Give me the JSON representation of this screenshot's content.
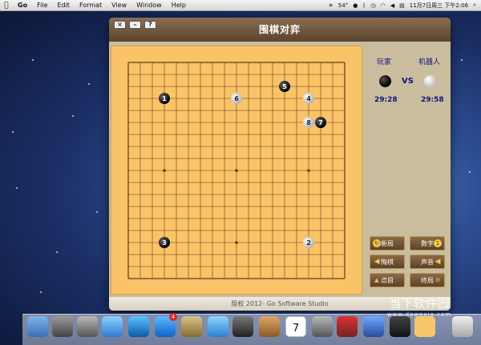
{
  "menubar": {
    "app": "Go",
    "items": [
      "File",
      "Edit",
      "Format",
      "View",
      "Window",
      "Help"
    ],
    "temperature": "54°",
    "datetime": "11月7日周三 下午2:06"
  },
  "window": {
    "title": "围棋对弈",
    "btn_close": "×",
    "btn_min": "–",
    "btn_help": "?",
    "footer": "版权 2012- Go Software Studio"
  },
  "panel": {
    "player_label": "玩家",
    "robot_label": "机器人",
    "vs": "VS",
    "player_time": "29:28",
    "robot_time": "29:58"
  },
  "controls": {
    "new_game": "新局",
    "numbers": "数字",
    "undo": "悔棋",
    "sound": "声音",
    "count": "点目",
    "end": "终局"
  },
  "board": {
    "size": 19,
    "stones": [
      {
        "n": "1",
        "col": 3,
        "row": 3,
        "color": "black"
      },
      {
        "n": "2",
        "col": 15,
        "row": 15,
        "color": "white"
      },
      {
        "n": "3",
        "col": 3,
        "row": 15,
        "color": "black"
      },
      {
        "n": "4",
        "col": 15,
        "row": 3,
        "color": "white"
      },
      {
        "n": "5",
        "col": 13,
        "row": 2,
        "color": "black"
      },
      {
        "n": "6",
        "col": 9,
        "row": 3,
        "color": "white"
      },
      {
        "n": "7",
        "col": 16,
        "row": 5,
        "color": "black"
      },
      {
        "n": "8",
        "col": 15,
        "row": 5,
        "color": "white"
      }
    ]
  },
  "dock": {
    "appstore_badge": "4",
    "calendar_day": "7"
  },
  "watermark": {
    "main": "当下软件园",
    "sub": "www.downxia.com"
  }
}
